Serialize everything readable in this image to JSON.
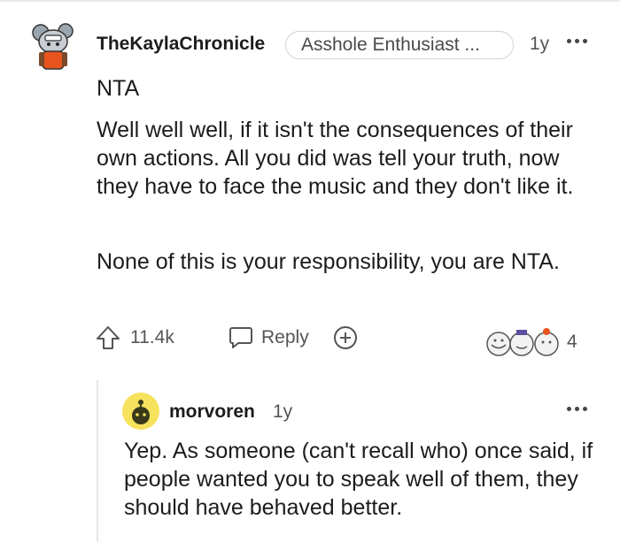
{
  "comment": {
    "username": "TheKaylaChronicle",
    "flair": "Asshole Enthusiast ...",
    "age": "1y",
    "paragraphs": [
      "NTA",
      "Well well well, if it isn't the consequences of their own actions. All you did was tell your truth, now they have to face the music and they don't like it.",
      "None of this is your responsibility, you are NTA."
    ],
    "upvotes": "11.4k",
    "reply_label": "Reply",
    "award_count": "4"
  },
  "reply": {
    "username": "morvoren",
    "age": "1y",
    "text": "Yep. As someone (can't recall who) once said, if people wanted you to speak well of them, they should have behaved better."
  },
  "icons": {
    "upvote": "upvote-arrow-icon",
    "reply": "speech-bubble-icon",
    "award": "add-award-icon",
    "more": "more-options-icon"
  },
  "colors": {
    "reply_avatar": "#f7e25e",
    "avatar_accent": "#e8541e"
  }
}
